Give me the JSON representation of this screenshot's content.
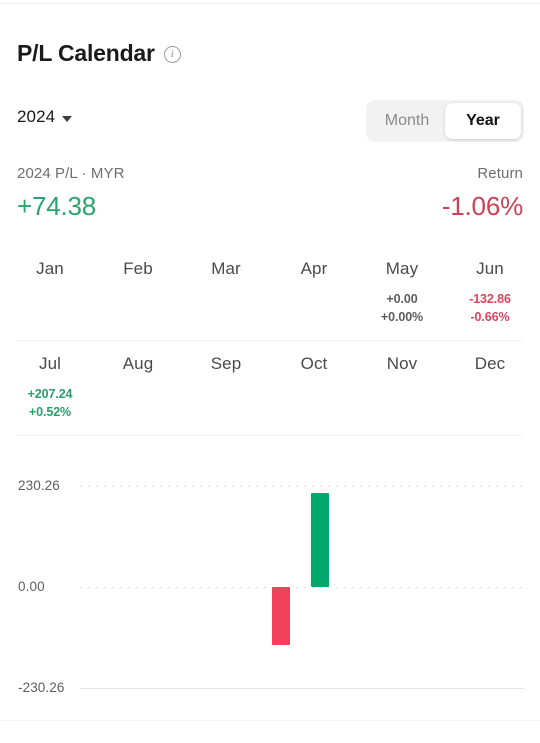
{
  "header": {
    "title": "P/L Calendar",
    "info_icon": "info-icon",
    "info_glyph": "i"
  },
  "controls": {
    "year": "2024",
    "caret_icon": "chevron-down-icon",
    "segments": [
      {
        "label": "Month",
        "active": false
      },
      {
        "label": "Year",
        "active": true
      }
    ]
  },
  "summary": {
    "pl_label": "2024 P/L · MYR",
    "pl_value": "+74.38",
    "pl_sign": "positive",
    "return_label": "Return",
    "return_value": "-1.06%",
    "return_sign": "negative"
  },
  "calendar": {
    "rows": [
      [
        {
          "month": "Jan",
          "pl": "",
          "pct": "",
          "sign": "none"
        },
        {
          "month": "Feb",
          "pl": "",
          "pct": "",
          "sign": "none"
        },
        {
          "month": "Mar",
          "pl": "",
          "pct": "",
          "sign": "none"
        },
        {
          "month": "Apr",
          "pl": "",
          "pct": "",
          "sign": "none"
        },
        {
          "month": "May",
          "pl": "+0.00",
          "pct": "+0.00%",
          "sign": "zero"
        },
        {
          "month": "Jun",
          "pl": "-132.86",
          "pct": "-0.66%",
          "sign": "negative"
        }
      ],
      [
        {
          "month": "Jul",
          "pl": "+207.24",
          "pct": "+0.52%",
          "sign": "positive"
        },
        {
          "month": "Aug",
          "pl": "",
          "pct": "",
          "sign": "none"
        },
        {
          "month": "Sep",
          "pl": "",
          "pct": "",
          "sign": "none"
        },
        {
          "month": "Oct",
          "pl": "",
          "pct": "",
          "sign": "none"
        },
        {
          "month": "Nov",
          "pl": "",
          "pct": "",
          "sign": "none"
        },
        {
          "month": "Dec",
          "pl": "",
          "pct": "",
          "sign": "none"
        }
      ]
    ]
  },
  "colors": {
    "positive": "#00a86b",
    "negative": "#f2415a",
    "positive_text": "#2ba36e",
    "negative_text": "#cf4055",
    "track": "#f2f2f3",
    "gridline": "#dcdcdf"
  },
  "chart_data": {
    "type": "bar",
    "title": "",
    "xlabel": "",
    "ylabel": "",
    "categories": [
      "Jan",
      "Feb",
      "Mar",
      "Apr",
      "May",
      "Jun",
      "Jul",
      "Aug",
      "Sep",
      "Oct",
      "Nov",
      "Dec"
    ],
    "values": [
      null,
      null,
      null,
      null,
      0,
      -132.86,
      207.24,
      null,
      null,
      null,
      null,
      null
    ],
    "ylim": [
      -230.26,
      230.26
    ],
    "yticks": [
      230.26,
      0.0,
      -230.26
    ],
    "ytick_labels": [
      "230.26",
      "0.00",
      "-230.26"
    ],
    "grid": true,
    "legend": false,
    "bar_colors": {
      "positive": "#00a86b",
      "negative": "#f2415a"
    }
  }
}
